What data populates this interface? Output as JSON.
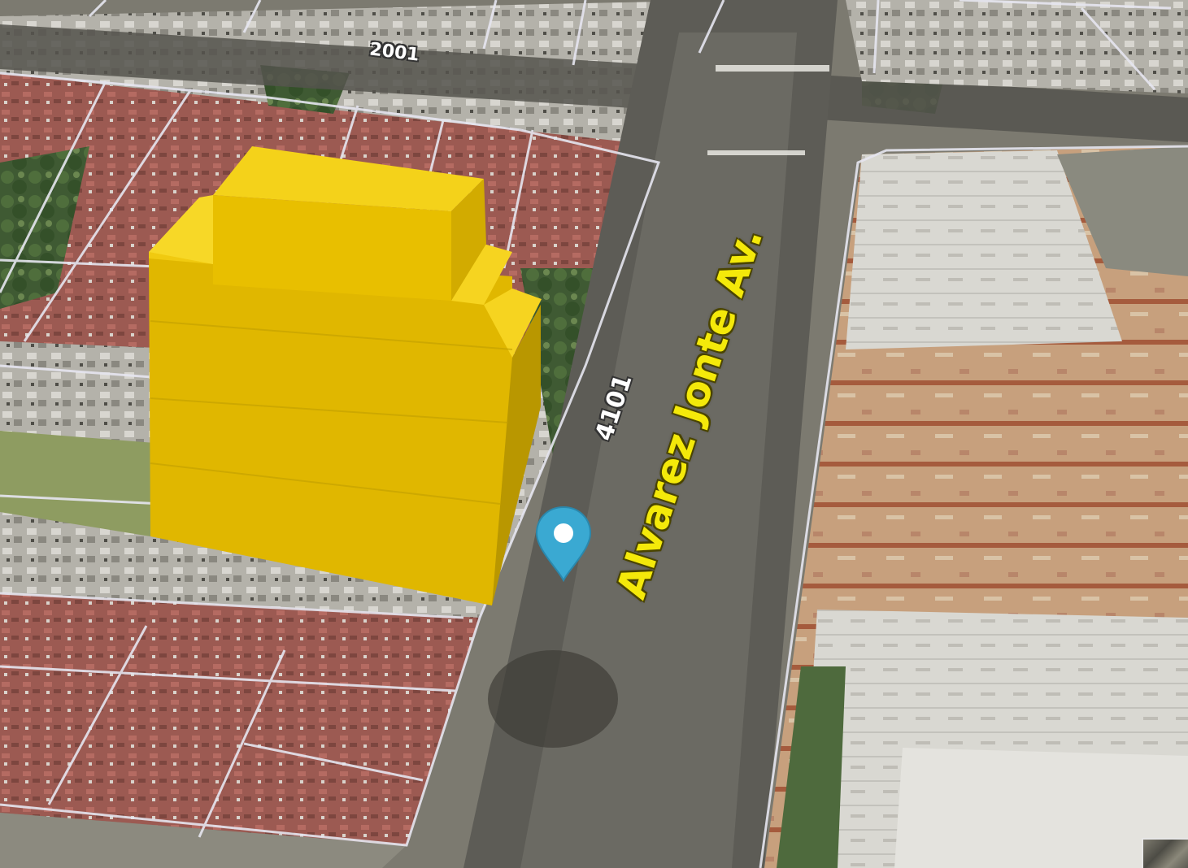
{
  "map": {
    "view": "3D satellite",
    "colors": {
      "building_highlight": "#f2c500",
      "marker": "#3aa9d2",
      "parcel_lines": "#e6e6f0",
      "street_label": "#f4e90a"
    }
  },
  "labels": {
    "main_street": "Alvarez Jonte Av.",
    "street_number_4101": "4101",
    "street_number_2001": "2001"
  },
  "marker": {
    "icon": "map-pin-icon"
  },
  "controls": {
    "corner_thumbnail_icon": "map-layer-thumbnail-icon"
  }
}
